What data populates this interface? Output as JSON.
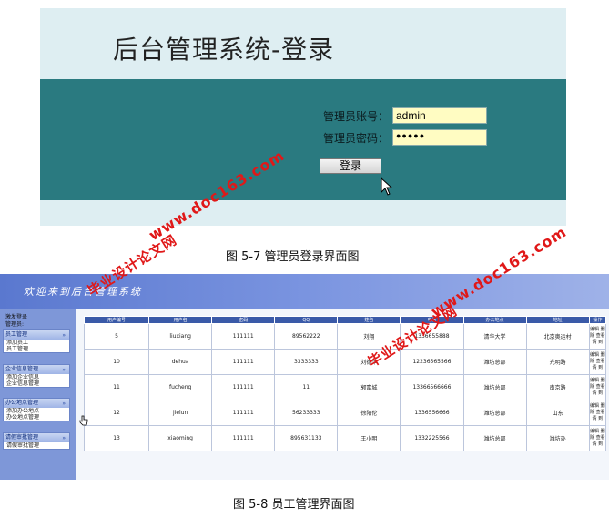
{
  "login": {
    "title": "后台管理系统-登录",
    "account_label": "管理员账号：",
    "account_value": "admin",
    "password_label": "管理员密码：",
    "password_value": "●●●●●",
    "login_button": "登录",
    "caption": "图 5-7  管理员登录界面图"
  },
  "watermarks": {
    "site": "www.doc163.com",
    "name": "毕业设计论文网"
  },
  "staff": {
    "welcome": "欢迎来到后台管理系统",
    "side_top": "激发登录",
    "side_user": "管理员:",
    "groups": [
      {
        "title": "员工管理",
        "items": [
          "添加员工",
          "员工管理"
        ]
      },
      {
        "title": "企业信息管理",
        "items": [
          "添加企业信息",
          "企业信息管理"
        ]
      },
      {
        "title": "办公地点管理",
        "items": [
          "添加办公地点",
          "办公地点管理"
        ]
      },
      {
        "title": "请假审批管理",
        "items": [
          "请假审批管理"
        ]
      }
    ],
    "columns": [
      "用户编号",
      "用户名",
      "密码",
      "QQ",
      "姓名",
      "电话",
      "办公地点",
      "地址",
      "操作"
    ],
    "rows": [
      [
        "5",
        "liuxiang",
        "111111",
        "89562222",
        "刘翔",
        "1336655888",
        "清华大学",
        "北京奥运村",
        "编辑 删除 查看请 到"
      ],
      [
        "10",
        "dehua",
        "111111",
        "3333333",
        "刘德华",
        "12236565566",
        "潍坊总部",
        "光明路",
        "编辑 删除 查看请 到"
      ],
      [
        "11",
        "fucheng",
        "111111",
        "11",
        "郭富城",
        "13366566666",
        "潍坊总部",
        "南京路",
        "编辑 删除 查看请 到"
      ],
      [
        "12",
        "jielun",
        "111111",
        "56233333",
        "徐阳伦",
        "1336556666",
        "潍坊总部",
        "山东",
        "编辑 删除 查看请 到"
      ],
      [
        "13",
        "xiaoming",
        "111111",
        "895631133",
        "王小明",
        "1332225566",
        "潍坊总部",
        "潍坊办",
        "编辑 删除 查看请 到"
      ]
    ],
    "caption": "图 5-8  员工管理界面图"
  }
}
